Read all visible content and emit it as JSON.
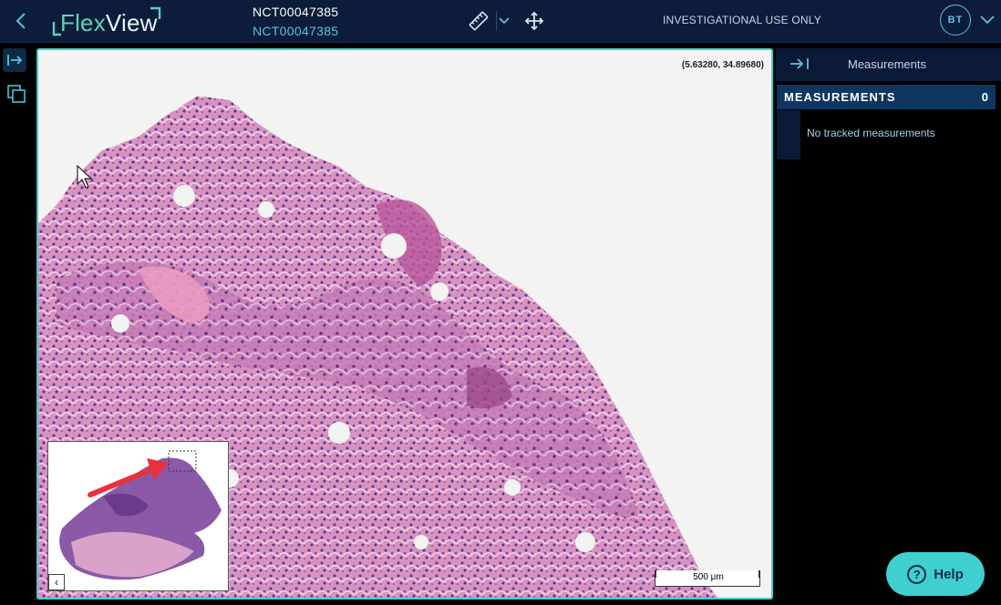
{
  "header": {
    "logo_text": "FlexView",
    "study_title": "NCT00047385",
    "study_subtitle": "NCT00047385",
    "banner": "INVESTIGATIONAL USE ONLY",
    "user_initials": "BT"
  },
  "viewer": {
    "coordinates": "(5.63280, 34.89680)",
    "scale_label": "500 μm",
    "minimap_collapse_label": "‹"
  },
  "panel": {
    "title": "Measurements",
    "section_label": "MEASUREMENTS",
    "count": "0",
    "empty_text": "No tracked measurements"
  },
  "help": {
    "label": "Help",
    "icon_glyph": "?"
  },
  "colors": {
    "topbar": "#0c1c3a",
    "accent": "#40cfd0",
    "viewer_border": "#3fcfcf",
    "section_bar": "#0e3660"
  }
}
